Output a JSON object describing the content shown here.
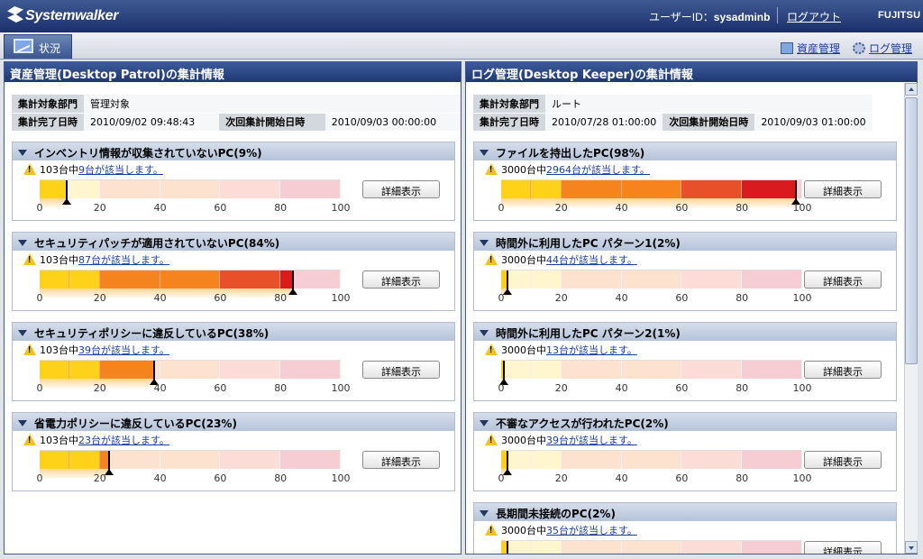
{
  "app": {
    "brand": "Systemwalker",
    "user_label": "ユーザーID：",
    "user_id": "sysadminb",
    "logout": "ログアウト",
    "vendor": "FUJITSU"
  },
  "toolbar": {
    "tab_status": "状況",
    "link_asset": "資産管理",
    "link_log": "ログ管理"
  },
  "left": {
    "title": "資産管理(Desktop Patrol)の集計情報",
    "info": {
      "dept_label": "集計対象部門",
      "dept_value": "管理対象",
      "done_label": "集計完了日時",
      "done_value": "2010/09/02 09:48:43",
      "next_label": "次回集計開始日時",
      "next_value": "2010/09/03 00:00:00"
    },
    "sections": [
      {
        "title": "インベントリ情報が収集されていないPC(9%)",
        "prefix": "103台中",
        "link": "9台が該当します。",
        "percent": 9,
        "button": "詳細表示"
      },
      {
        "title": "セキュリティパッチが適用されていないPC(84%)",
        "prefix": "103台中",
        "link": "87台が該当します。",
        "percent": 84,
        "button": "詳細表示"
      },
      {
        "title": "セキュリティポリシーに違反しているPC(38%)",
        "prefix": "103台中",
        "link": "39台が該当します。",
        "percent": 38,
        "button": "詳細表示"
      },
      {
        "title": "省電力ポリシーに違反しているPC(23%)",
        "prefix": "103台中",
        "link": "23台が該当します。",
        "percent": 23,
        "button": "詳細表示"
      }
    ]
  },
  "right": {
    "title": "ログ管理(Desktop Keeper)の集計情報",
    "info": {
      "dept_label": "集計対象部門",
      "dept_value": "ルート",
      "done_label": "集計完了日時",
      "done_value": "2010/07/28 01:00:00",
      "next_label": "次回集計開始日時",
      "next_value": "2010/09/03 01:00:00"
    },
    "sections": [
      {
        "title": "ファイルを持出したPC(98%)",
        "prefix": "3000台中",
        "link": "2964台が該当します。",
        "percent": 98,
        "button": "詳細表示"
      },
      {
        "title": "時間外に利用したPC パターン1(2%)",
        "prefix": "3000台中",
        "link": "44台が該当します。",
        "percent": 2,
        "button": "詳細表示"
      },
      {
        "title": "時間外に利用したPC パターン2(1%)",
        "prefix": "3000台中",
        "link": "13台が該当します。",
        "percent": 1,
        "button": "詳細表示"
      },
      {
        "title": "不審なアクセスが行われたPC(2%)",
        "prefix": "3000台中",
        "link": "39台が該当します。",
        "percent": 2,
        "button": "詳細表示"
      },
      {
        "title": "長期間未接続のPC(2%)",
        "prefix": "3000台中",
        "link": "35台が該当します。",
        "percent": 2,
        "button": "詳細表示"
      }
    ]
  },
  "gauge_ticks": [
    "0",
    "20",
    "40",
    "60",
    "80",
    "100"
  ],
  "colors": {
    "fill_0": "#ffd21a",
    "fill_1": "#f5841e",
    "fill_2": "#e8502a",
    "fill_3": "#d91a1f",
    "pale_0": "#fff6cf",
    "pale_1": "#fce2cf",
    "pale_2": "#fbdcd6",
    "pale_3": "#f6cdd2"
  }
}
